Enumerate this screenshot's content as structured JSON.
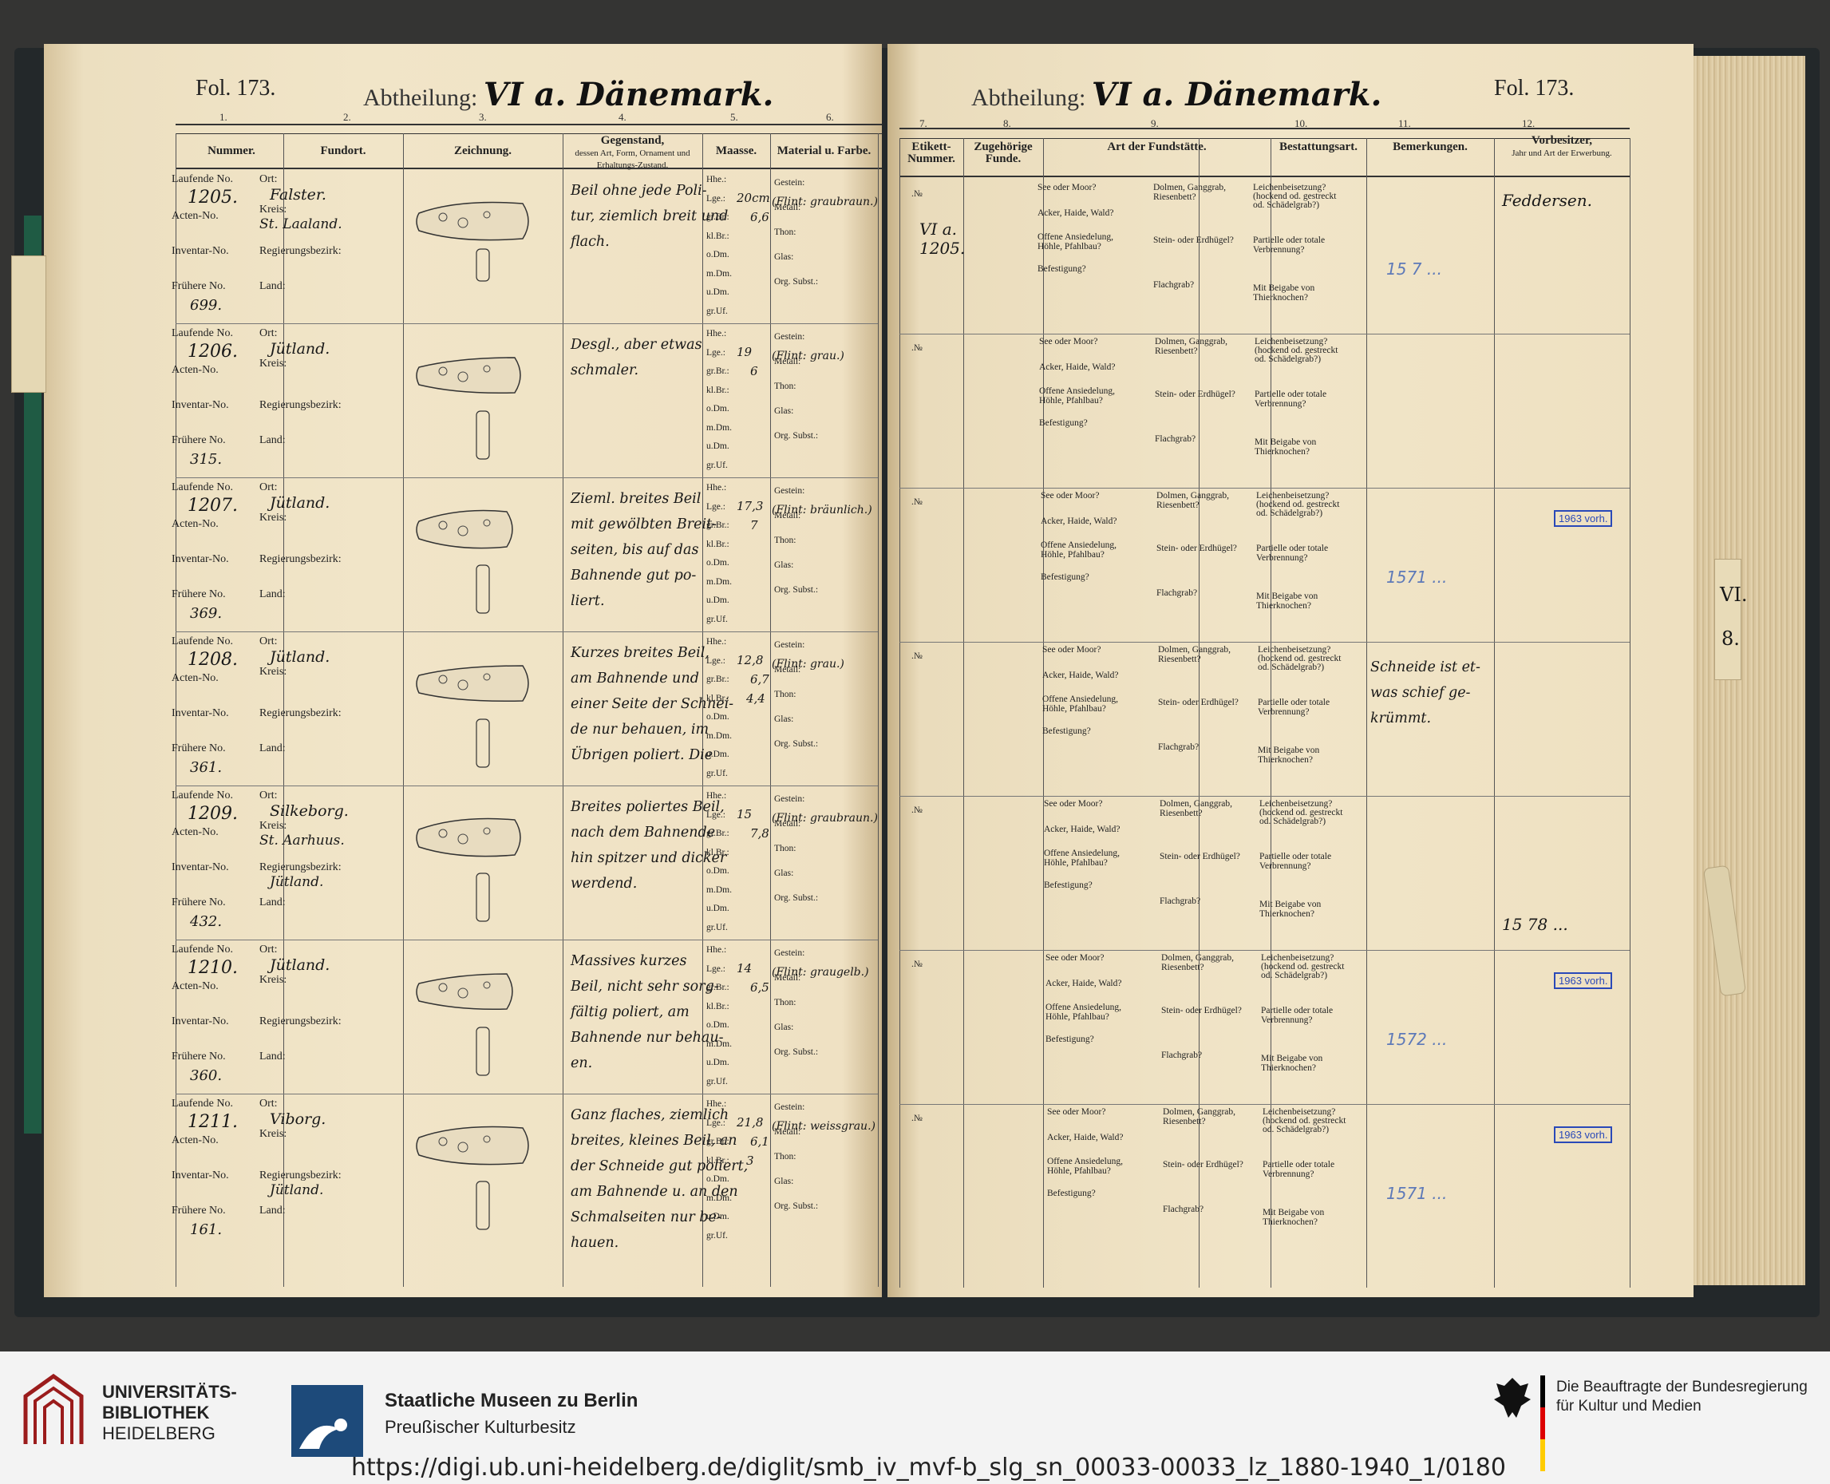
{
  "left_page": {
    "folio": "Fol. 173.",
    "abtheilung_label": "Abtheilung:",
    "abtheilung_value": "VI a. Dänemark.",
    "column_numbers": [
      "1.",
      "2.",
      "3.",
      "4.",
      "5.",
      "6."
    ],
    "headers": {
      "nummer": "Nummer.",
      "fundort": "Fundort.",
      "zeichnung": "Zeichnung.",
      "gegenstand": "Gegenstand,",
      "gegenstand_sub": "dessen Art, Form, Ornament und Erhaltungs-Zustand.",
      "maasse": "Maasse.",
      "material": "Material u. Farbe."
    }
  },
  "right_page": {
    "folio": "Fol. 173.",
    "abtheilung_label": "Abtheilung:",
    "abtheilung_value": "VI a. Dänemark.",
    "column_numbers": [
      "7.",
      "8.",
      "9.",
      "10.",
      "11.",
      "12."
    ],
    "headers": {
      "etikett": "Etikett-Nummer.",
      "zugehoerige": "Zugehörige Funde.",
      "art": "Art der Fundstätte.",
      "bestattung": "Bestattungsart.",
      "bemerkungen": "Bemerkungen.",
      "vorbesitzer": "Vorbesitzer,",
      "vorbesitzer_sub": "Jahr und Art der Erwerbung."
    }
  },
  "labels": {
    "laufende": "Laufende No.",
    "acten": "Acten-No.",
    "inventar": "Inventar-No.",
    "fruehere": "Frühere No.",
    "ort": "Ort:",
    "kreis": "Kreis:",
    "regbez": "Regierungsbezirk:",
    "land": "Land:",
    "maasse": [
      "Hhe.:",
      "Lge.:",
      "gr.Br.:",
      "kl.Br.:",
      "o.Dm.",
      "m.Dm.",
      "u.Dm.",
      "gr.Uf."
    ],
    "material": [
      "Gestein:",
      "Metall:",
      "Thon:",
      "Glas:",
      "Org. Subst.:"
    ],
    "fundstaette": [
      "See oder Moor?",
      "Acker, Haide, Wald?",
      "Offene Ansiedelung,",
      "Höhle, Pfahlbau?",
      "Befestigung?"
    ],
    "grab": [
      "Dolmen, Ganggrab,",
      "Riesenbett?",
      "Stein- oder Erdhügel?",
      "Flachgrab?"
    ],
    "bestattung": [
      "Leichenbeisetzung?",
      "(hockend od. gestreckt",
      "od. Schädelgrab?)",
      "Partielle oder totale",
      "Verbrennung?",
      "Mit Beigabe von",
      "Thierknochen?"
    ]
  },
  "entries": [
    {
      "laufende": "1205.",
      "fruehere": "699.",
      "ort": "Falster.",
      "kreis": "St. Laaland.",
      "land": "",
      "desc": [
        "Beil ohne jede Poli-",
        "tur, ziemlich breit und",
        "flach."
      ],
      "lge": "20cm",
      "grbr": "6,6",
      "klbr": "",
      "hhe": "",
      "flint": "(Flint: graubraun.)",
      "etikett": "VI a. 1205.",
      "bemerkung": "",
      "vorbesitzer": "Feddersen.",
      "stamp": "",
      "pencil": "15 7 ..."
    },
    {
      "laufende": "1206.",
      "fruehere": "315.",
      "ort": "Jütland.",
      "kreis": "",
      "land": "",
      "desc": [
        "Desgl., aber etwas",
        "schmaler."
      ],
      "lge": "19",
      "grbr": "6",
      "klbr": "",
      "hhe": "",
      "flint": "(Flint: grau.)",
      "etikett": "",
      "bemerkung": "",
      "vorbesitzer": "",
      "stamp": "",
      "pencil": ""
    },
    {
      "laufende": "1207.",
      "fruehere": "369.",
      "ort": "Jütland.",
      "kreis": "",
      "land": "",
      "desc": [
        "Zieml. breites Beil",
        "mit gewölbten Breit-",
        "seiten, bis auf das",
        "Bahnende gut po-",
        "liert."
      ],
      "lge": "17,3",
      "grbr": "7",
      "klbr": "",
      "hhe": "",
      "flint": "(Flint: bräunlich.)",
      "etikett": "",
      "bemerkung": "",
      "vorbesitzer": "",
      "stamp": "1963 vorh.",
      "pencil": "1571 ..."
    },
    {
      "laufende": "1208.",
      "fruehere": "361.",
      "ort": "Jütland.",
      "kreis": "",
      "land": "",
      "desc": [
        "Kurzes breites Beil,",
        "am Bahnende und",
        "einer Seite der Schnei-",
        "de nur behauen, im",
        "Übrigen poliert. Die"
      ],
      "lge": "12,8",
      "grbr": "6,7",
      "klbr": "4,4",
      "hhe": "",
      "flint": "(Flint: grau.)",
      "etikett": "",
      "bemerkung": "Schneide ist et-was schief ge-krümmt.",
      "vorbesitzer": "",
      "stamp": "",
      "pencil": ""
    },
    {
      "laufende": "1209.",
      "fruehere": "432.",
      "ort": "Silkeborg.",
      "kreis": "St. Aarhuus.",
      "land": "Jütland.",
      "desc": [
        "Breites poliertes Beil,",
        "nach dem Bahnende",
        "hin spitzer und dicker",
        "werdend."
      ],
      "lge": "15",
      "grbr": "7,8",
      "klbr": "",
      "hhe": "",
      "flint": "(Flint: graubraun.)",
      "etikett": "",
      "bemerkung": "",
      "vorbesitzer": "15 78 ...",
      "stamp": "",
      "pencil": ""
    },
    {
      "laufende": "1210.",
      "fruehere": "360.",
      "ort": "Jütland.",
      "kreis": "",
      "land": "",
      "desc": [
        "Massives kurzes",
        "Beil, nicht sehr sorg-",
        "fältig poliert, am",
        "Bahnende nur behau-",
        "en."
      ],
      "lge": "14",
      "grbr": "6,5",
      "klbr": "",
      "hhe": "",
      "flint": "(Flint: graugelb.)",
      "etikett": "",
      "bemerkung": "",
      "vorbesitzer": "",
      "stamp": "1963 vorh.",
      "pencil": "1572 ..."
    },
    {
      "laufende": "1211.",
      "fruehere": "161.",
      "ort": "Viborg.",
      "kreis": "",
      "land": "Jütland.",
      "desc": [
        "Ganz flaches, ziemlich",
        "breites, kleines Beil, an",
        "der Schneide gut poliert,",
        "am Bahnende u. an den",
        "Schmalseiten nur be-",
        "hauen."
      ],
      "lge": "21,8",
      "grbr": "6,1",
      "klbr": "3",
      "hhe": "",
      "flint": "(Flint: weissgrau.)",
      "etikett": "",
      "bemerkung": "",
      "vorbesitzer": "",
      "stamp": "1963 vorh.",
      "pencil": "1571 ..."
    }
  ],
  "tab_label": [
    "VI.",
    "8."
  ],
  "footer": {
    "uni_line1": "UNIVERSITÄTS-",
    "uni_line2": "BIBLIOTHEK",
    "uni_line3": "HEIDELBERG",
    "smb_line1": "Staatliche Museen zu Berlin",
    "smb_line2": "Preußischer Kulturbesitz",
    "bkm_line1": "Die Beauftragte der Bundesregierung",
    "bkm_line2": "für Kultur und Medien",
    "url": "https://digi.ub.uni-heidelberg.de/diglit/smb_iv_mvf-b_slg_sn_00033-00033_lz_1880-1940_1/0180"
  },
  "colors": {
    "stamp_blue": "#2a49b8",
    "pencil_blue": "#5d79b8",
    "paper": "#efe1c2",
    "cloth_green": "#1f5b44"
  }
}
